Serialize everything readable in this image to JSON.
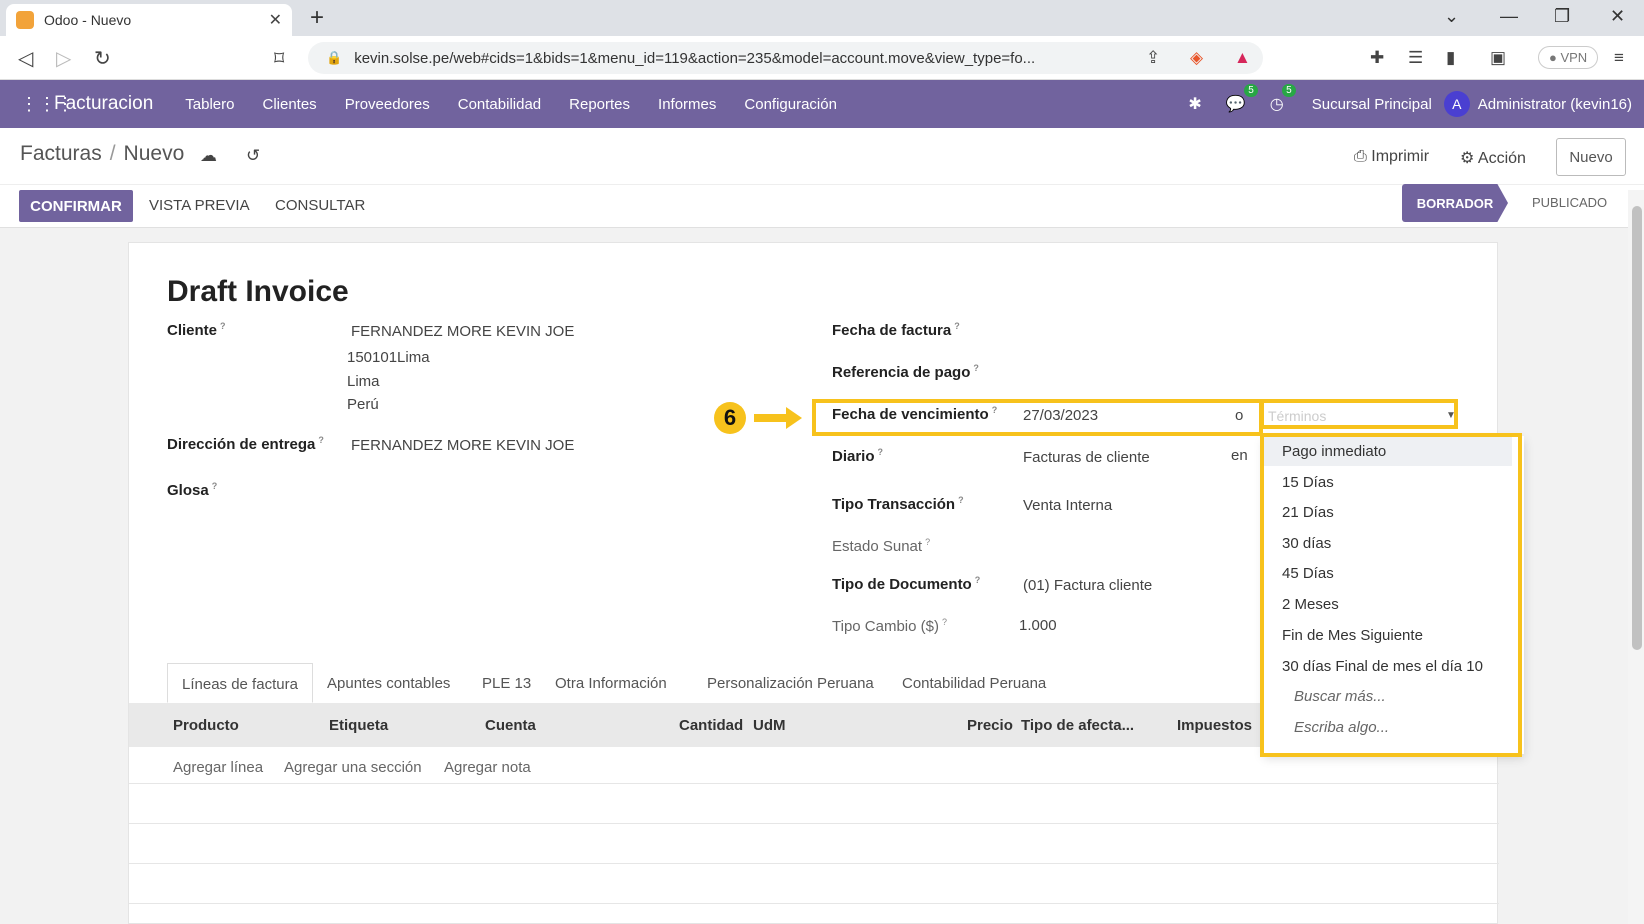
{
  "browser": {
    "tab_title": "Odoo - Nuevo",
    "url": "kevin.solse.pe/web#cids=1&bids=1&menu_id=119&action=235&model=account.move&view_type=fo...",
    "vpn_label": "VPN"
  },
  "navbar": {
    "brand": "Facturacion",
    "menu": [
      "Tablero",
      "Clientes",
      "Proveedores",
      "Contabilidad",
      "Reportes",
      "Informes",
      "Configuración"
    ],
    "messages_count": "5",
    "activities_count": "5",
    "branch": "Sucursal Principal",
    "avatar_initial": "A",
    "user": "Administrator (kevin16)",
    "accent_color": "#71639e"
  },
  "control_panel": {
    "breadcrumb_parent": "Facturas",
    "breadcrumb_current": "Nuevo",
    "print_label": "Imprimir",
    "action_label": "Acción",
    "new_button": "Nuevo",
    "confirm_button": "CONFIRMAR",
    "preview_button": "VISTA PREVIA",
    "consult_button": "CONSULTAR",
    "status_draft": "BORRADOR",
    "status_published": "PUBLICADO"
  },
  "form": {
    "title": "Draft Invoice",
    "cliente_label": "Cliente",
    "cliente_name": "FERNANDEZ MORE KEVIN JOE",
    "cliente_addr1": "150101Lima",
    "cliente_addr2": "Lima",
    "cliente_addr3": "Perú",
    "entrega_label": "Dirección de entrega",
    "entrega_value": "FERNANDEZ MORE KEVIN JOE",
    "glosa_label": "Glosa",
    "fecha_factura_label": "Fecha de factura",
    "ref_pago_label": "Referencia de pago",
    "vencimiento_label": "Fecha de vencimiento",
    "vencimiento_value": "27/03/2023",
    "vencimiento_or": "o",
    "terminos_placeholder": "Términos",
    "diario_label": "Diario",
    "diario_value": "Facturas de cliente",
    "diario_en": "en",
    "tipo_trans_label": "Tipo Transacción",
    "tipo_trans_value": "Venta Interna",
    "estado_sunat_label": "Estado Sunat",
    "tipo_doc_label": "Tipo de Documento",
    "tipo_doc_value": "(01) Factura cliente",
    "tipo_cambio_label": "Tipo Cambio ($)",
    "tipo_cambio_value": "1.000",
    "help_mark": "?"
  },
  "tabs": [
    "Líneas de factura",
    "Apuntes contables",
    "PLE 13",
    "Otra Información",
    "Personalización Peruana",
    "Contabilidad Peruana"
  ],
  "grid_columns": [
    "Producto",
    "Etiqueta",
    "Cuenta",
    "Cantidad",
    "UdM",
    "Precio",
    "Tipo de afecta...",
    "Impuestos"
  ],
  "grid_actions": [
    "Agregar línea",
    "Agregar una sección",
    "Agregar nota"
  ],
  "dropdown": {
    "items": [
      "Pago inmediato",
      "15 Días",
      "21 Días",
      "30 días",
      "45 Días",
      "2 Meses",
      "Fin de Mes Siguiente",
      "30 días Final de mes el día 10"
    ],
    "search_more": "Buscar más...",
    "type_something": "Escriba algo..."
  },
  "annotation": {
    "step": "6",
    "highlight_color": "#f7c21c"
  }
}
